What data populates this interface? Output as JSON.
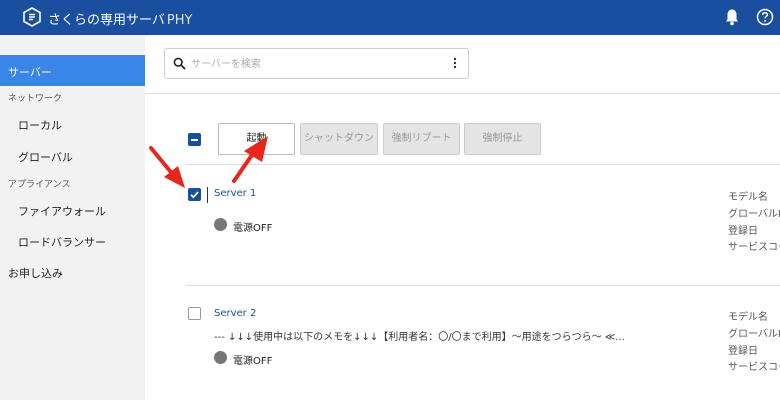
{
  "header": {
    "brand": "さくらの専用サーバ",
    "product": "PHY",
    "colors": {
      "bar": "#1a4fa0"
    }
  },
  "sidebar": {
    "active": "サーバー",
    "network_label": "ネットワーク",
    "network_items": [
      "ローカル",
      "グローバル"
    ],
    "appliance_label": "アプライアンス",
    "appliance_items": [
      "ファイアウォール",
      "ロードバランサー"
    ],
    "apply": "お申し込み"
  },
  "search": {
    "placeholder": "サーバーを検索"
  },
  "toolbar": {
    "start": "起動",
    "shutdown": "シャットダウン",
    "force_reboot": "強制リブート",
    "force_stop": "強制停止"
  },
  "servers": [
    {
      "name": "Server 1",
      "checked": true,
      "memo": "",
      "power": "電源OFF",
      "meta": [
        "モデル名",
        "グローバルIP",
        "登録日",
        "サービスコード"
      ]
    },
    {
      "name": "Server 2",
      "checked": false,
      "memo": "--- ↓↓↓使用中は以下のメモを↓↓↓【利用者名：〇/〇まで利用】～用途をつらつら～ ≪...",
      "power": "電源OFF",
      "meta": [
        "モデル名",
        "グローバルIP",
        "登録日",
        "サービスコード"
      ]
    }
  ]
}
